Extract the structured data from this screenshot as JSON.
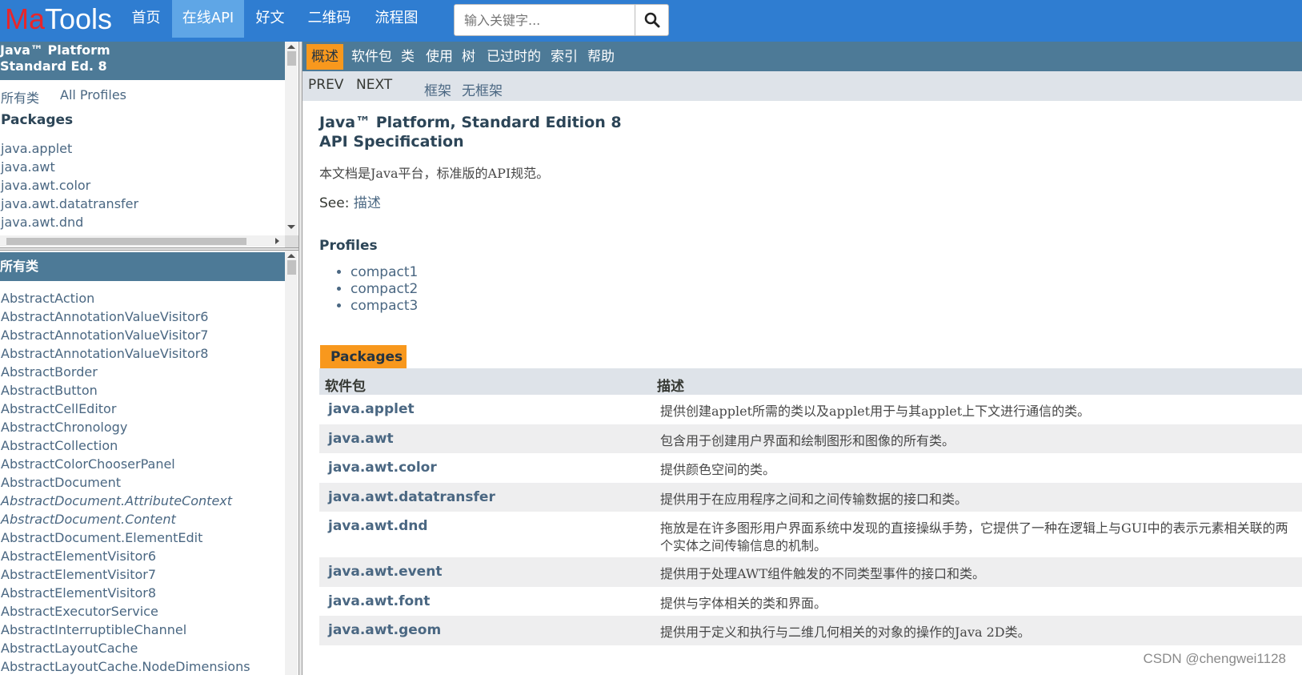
{
  "topnav": {
    "logo_ma": "Ma",
    "logo_tools": "Tools",
    "items": [
      "首页",
      "在线API",
      "好文",
      "二维码",
      "流程图"
    ],
    "search_placeholder": "输入关键字..."
  },
  "left_top": {
    "header_line1": "Java™ Platform",
    "header_line2": "Standard Ed. 8",
    "link_all_classes": "所有类",
    "link_all_profiles": "All Profiles",
    "packages_title": "Packages",
    "packages": [
      "java.applet",
      "java.awt",
      "java.awt.color",
      "java.awt.datatransfer",
      "java.awt.dnd"
    ]
  },
  "left_bottom": {
    "header": "所有类",
    "classes": [
      "AbstractAction",
      "AbstractAnnotationValueVisitor6",
      "AbstractAnnotationValueVisitor7",
      "AbstractAnnotationValueVisitor8",
      "AbstractBorder",
      "AbstractButton",
      "AbstractCellEditor",
      "AbstractChronology",
      "AbstractCollection",
      "AbstractColorChooserPanel",
      "AbstractDocument",
      "AbstractDocument.AttributeContext",
      "AbstractDocument.Content",
      "AbstractDocument.ElementEdit",
      "AbstractElementVisitor6",
      "AbstractElementVisitor7",
      "AbstractElementVisitor8",
      "AbstractExecutorService",
      "AbstractInterruptibleChannel",
      "AbstractLayoutCache",
      "AbstractLayoutCache.NodeDimensions"
    ],
    "italic_classes": [
      "AbstractDocument.AttributeContext",
      "AbstractDocument.Content"
    ]
  },
  "main": {
    "nav": [
      "概述",
      "软件包",
      "类",
      "使用",
      "树",
      "已过时的",
      "索引",
      "帮助"
    ],
    "sub_prev": "PREV",
    "sub_next": "NEXT",
    "sub_frames": "框架",
    "sub_noframes": "无框架",
    "title_line1": "Java™ Platform, Standard Edition 8",
    "title_line2": "API Specification",
    "description": "本文档是Java平台，标准版的API规范。",
    "see_label": "See: ",
    "see_link": "描述",
    "profiles_title": "Profiles",
    "profiles": [
      "compact1",
      "compact2",
      "compact3"
    ],
    "packages_caption": "Packages",
    "table_header_pkg": "软件包",
    "table_header_desc": "描述",
    "rows": [
      {
        "name": "java.applet",
        "desc": "提供创建applet所需的类以及applet用于与其applet上下文进行通信的类。"
      },
      {
        "name": "java.awt",
        "desc": "包含用于创建用户界面和绘制图形和图像的所有类。"
      },
      {
        "name": "java.awt.color",
        "desc": "提供颜色空间的类。"
      },
      {
        "name": "java.awt.datatransfer",
        "desc": "提供用于在应用程序之间和之间传输数据的接口和类。"
      },
      {
        "name": "java.awt.dnd",
        "desc": "拖放是在许多图形用户界面系统中发现的直接操纵手势，它提供了一种在逻辑上与GUI中的表示元素相关联的两个实体之间传输信息的机制。"
      },
      {
        "name": "java.awt.event",
        "desc": "提供用于处理AWT组件触发的不同类型事件的接口和类。"
      },
      {
        "name": "java.awt.font",
        "desc": "提供与字体相关的类和界面。"
      },
      {
        "name": "java.awt.geom",
        "desc": "提供用于定义和执行与二维几何相关的对象的操作的Java 2D类。"
      }
    ]
  },
  "watermark": "CSDN @chengwei1128"
}
